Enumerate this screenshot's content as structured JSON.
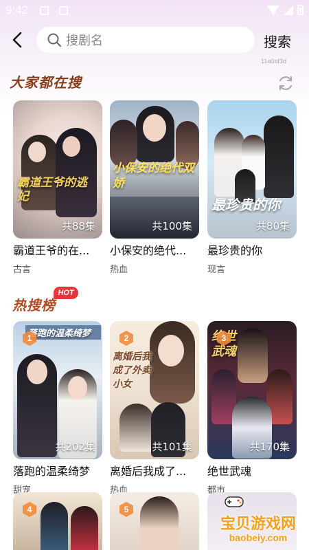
{
  "status_bar": {
    "time": "9:42"
  },
  "header": {
    "search_placeholder": "搜剧名",
    "search_button": "搜索",
    "small_id": "11a0af3d"
  },
  "sections": {
    "popular": {
      "title": "大家都在搜",
      "items": [
        {
          "title": "霸道王爷的在...",
          "tag": "古言",
          "episodes": "共88集"
        },
        {
          "title": "小保安的绝代...",
          "tag": "热血",
          "episodes": "共100集"
        },
        {
          "title": "最珍贵的你",
          "tag": "现言",
          "episodes": "共80集"
        }
      ]
    },
    "hot": {
      "title": "热搜榜",
      "badge": "HOT",
      "items": [
        {
          "rank": "1",
          "title": "落跑的温柔绮梦",
          "tag": "甜宠",
          "episodes": "共202集"
        },
        {
          "rank": "2",
          "title": "离婚后我成了...",
          "tag": "热血",
          "episodes": "共101集"
        },
        {
          "rank": "3",
          "title": "绝世武魂",
          "tag": "都市",
          "episodes": "共170集"
        }
      ],
      "more_ranks": [
        "4",
        "5"
      ]
    }
  },
  "cover_art_text": {
    "c1": "霸道王爷的逃妃",
    "c2": "小保安的绝代双娇",
    "c3": "最珍贵的你",
    "c4": "落跑的温柔绮梦",
    "c5": "离婚后我成了外卖小女",
    "c6": "绝世武魂"
  },
  "watermark": {
    "text": "宝贝游戏网",
    "url": "baobeiy.com"
  },
  "colors": {
    "section_title": "#8a3d1a",
    "hot_badge": "#e8343b",
    "watermark": "#f4a21c"
  }
}
